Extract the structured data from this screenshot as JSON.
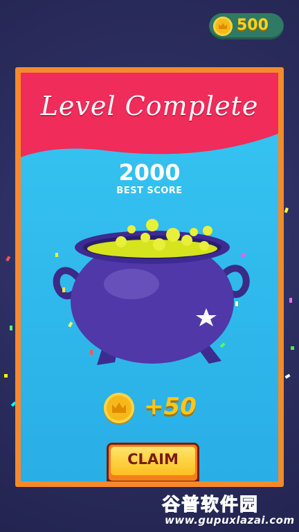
{
  "wallet": {
    "coins": "500",
    "icon": "crown-coin-icon"
  },
  "dialog": {
    "title": "Level Complete",
    "score": "2000",
    "score_label": "BEST SCORE",
    "reward_amount": "+50",
    "reward_icon": "crown-coin-icon",
    "claim_label": "CLAIM"
  },
  "watermark": {
    "title": "谷普软件园",
    "url": "www.gupuxlazai.com"
  },
  "colors": {
    "banner": "#ef2c5a",
    "card_border": "#f58a2c",
    "card_bg": "#37c6f2",
    "cauldron": "#5038a8",
    "potion": "#d6e31f",
    "coin": "#f6b81a"
  }
}
